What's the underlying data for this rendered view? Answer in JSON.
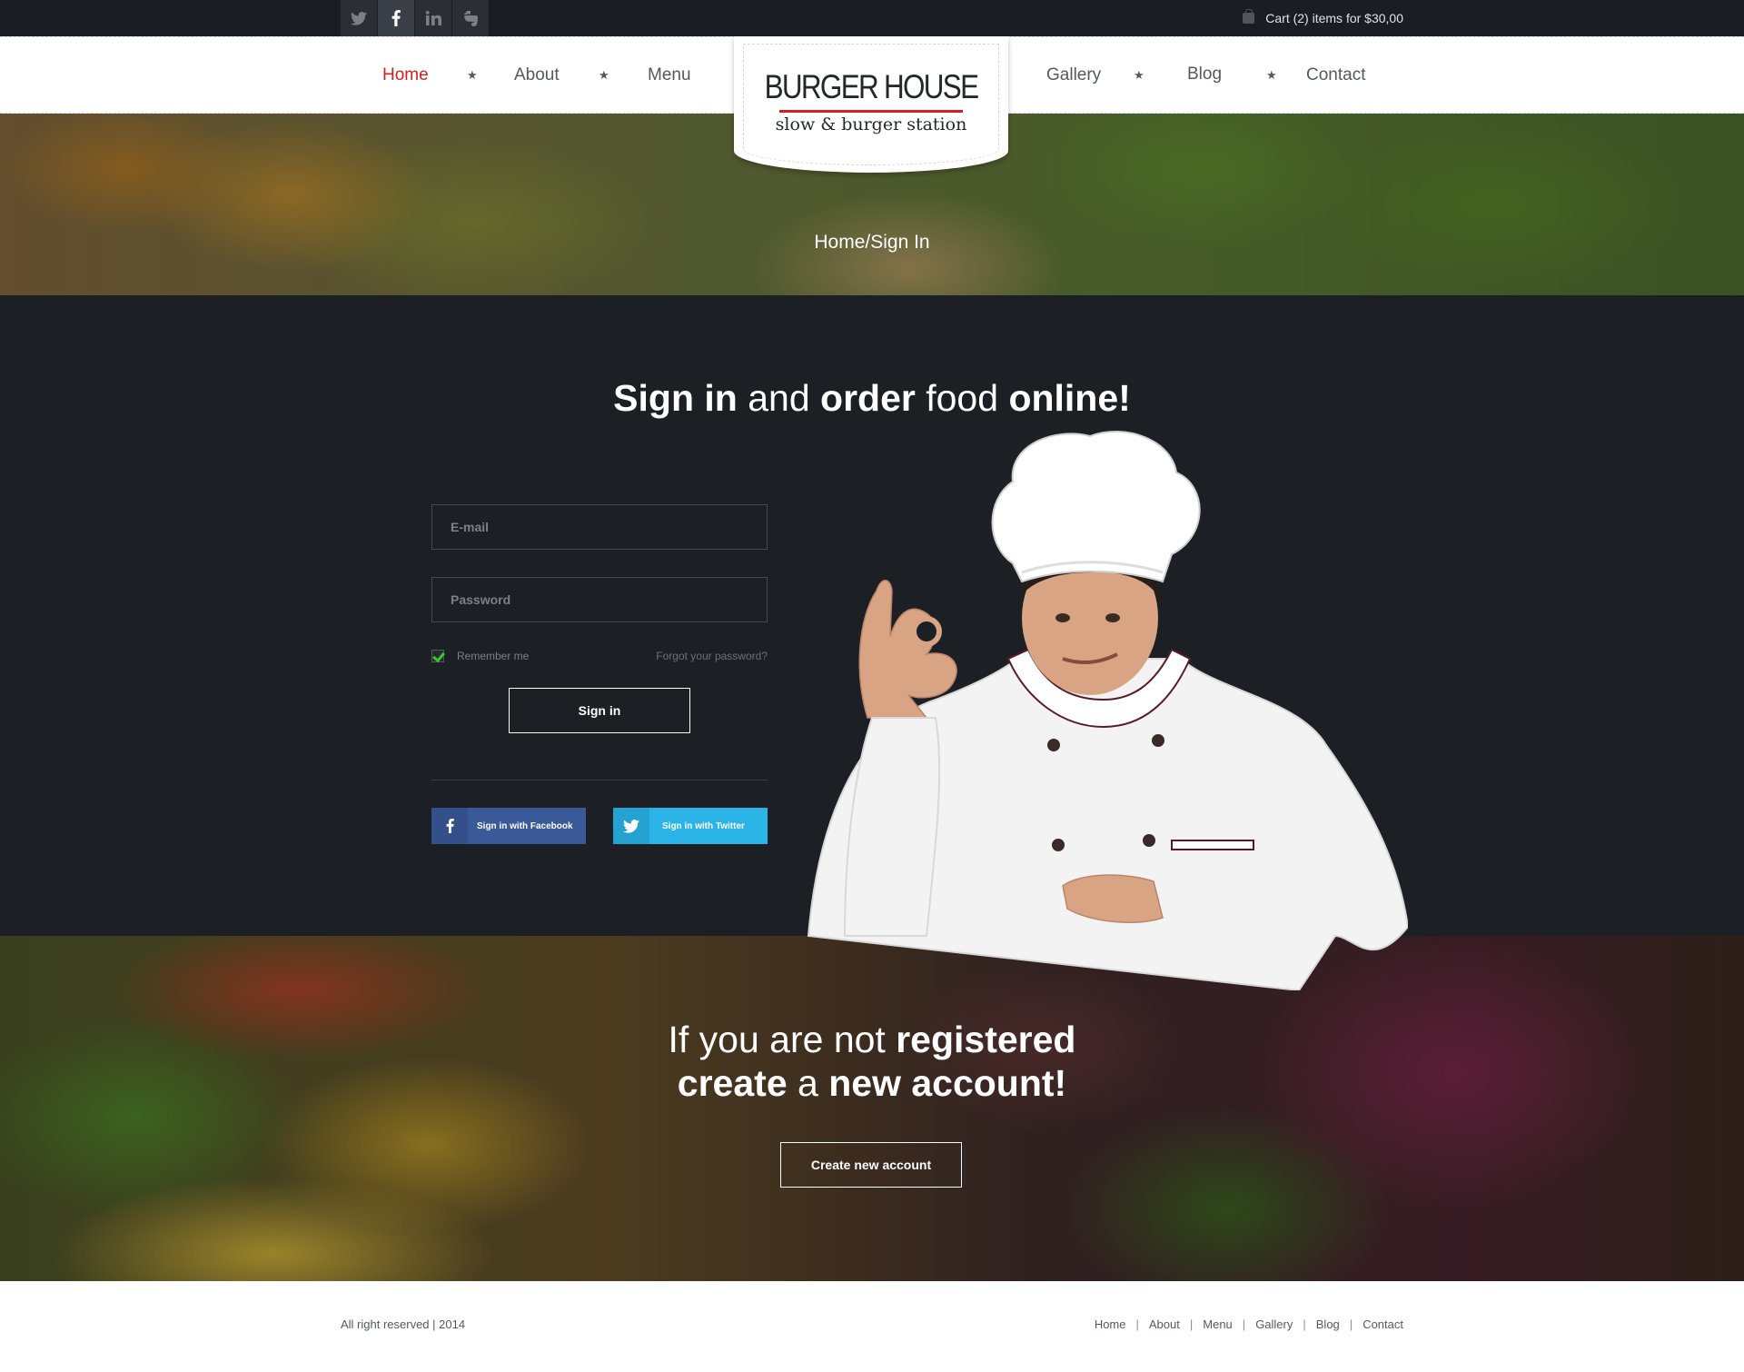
{
  "topbar": {
    "social": [
      {
        "icon": "twitter-icon",
        "glyph": "t"
      },
      {
        "icon": "facebook-icon",
        "glyph": "f"
      },
      {
        "icon": "linkedin-icon",
        "glyph": "in"
      },
      {
        "icon": "evernote-icon",
        "glyph": "e"
      }
    ],
    "cart_text": "Cart (2) items for $30,00"
  },
  "nav": {
    "home": "Home",
    "about": "About",
    "menu": "Menu",
    "gallery": "Gallery",
    "blog": "Blog",
    "contact": "Contact",
    "separator": "★",
    "active_color": "#d52021"
  },
  "logo": {
    "title": "BURGER HOUSE",
    "subtitle": "slow & burger station"
  },
  "hero": {
    "breadcrumb": "Home/Sign In"
  },
  "signin": {
    "headline_1": "Sign in",
    "headline_2": " and ",
    "headline_3": "order",
    "headline_4": " food ",
    "headline_5": "online!",
    "email_placeholder": "E-mail",
    "password_placeholder": "Password",
    "remember_label": "Remember me",
    "remember_checked": true,
    "forgot_label": "Forgot your password?",
    "button_label": "Sign in",
    "facebook_label": "Sign in with Facebook",
    "twitter_label": "Sign in with Twitter"
  },
  "register": {
    "line1_a": "If you are not ",
    "line1_b": "registered",
    "line2_a": "create",
    "line2_b": " a ",
    "line2_c": "new account!",
    "button_label": "Create new account"
  },
  "footer": {
    "copyright": "All right reserved | 2014",
    "links": [
      "Home",
      "About",
      "Menu",
      "Gallery",
      "Blog",
      "Contact"
    ],
    "separator": "|"
  }
}
